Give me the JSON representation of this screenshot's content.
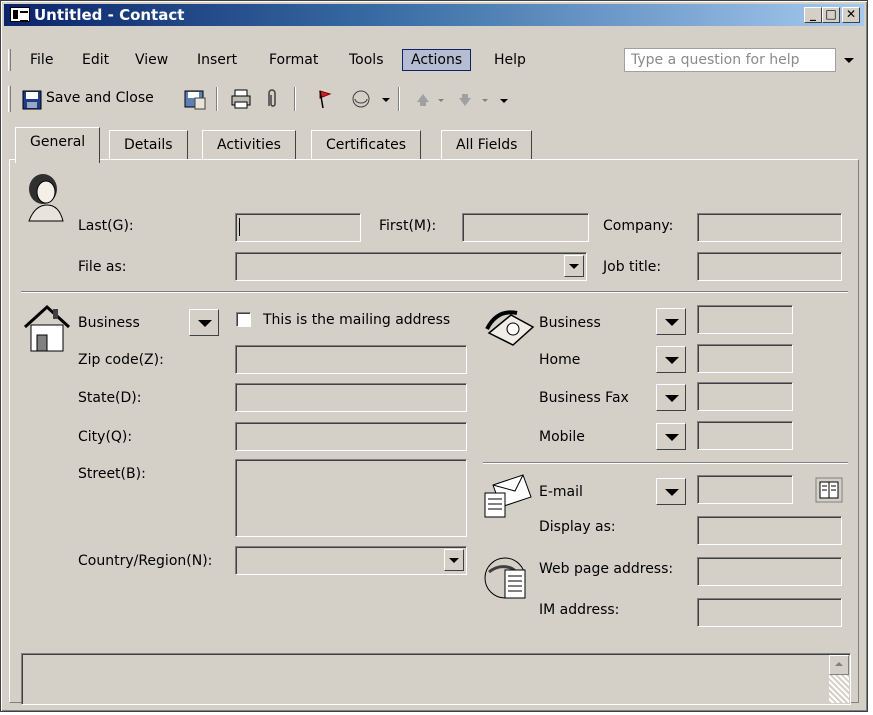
{
  "window": {
    "title": "Untitled - Contact"
  },
  "caption_buttons": {
    "minimize": "_",
    "maximize": "□",
    "close": "✕"
  },
  "menu": {
    "items": [
      "File",
      "Edit",
      "View",
      "Insert",
      "Format",
      "Tools",
      "Actions",
      "Help"
    ],
    "help_placeholder": "Type a question for help"
  },
  "toolbar": {
    "save_close": "Save and Close"
  },
  "tabs": [
    "General",
    "Details",
    "Activities",
    "Certificates",
    "All Fields"
  ],
  "name_section": {
    "last_label": "Last(G):",
    "first_label": "First(M):",
    "company_label": "Company:",
    "file_as_label": "File as:",
    "job_title_label": "Job title:"
  },
  "address_section": {
    "type": "Business",
    "mailing_label": "This is the mailing address",
    "zip_label": "Zip code(Z):",
    "state_label": "State(D):",
    "city_label": "City(Q):",
    "street_label": "Street(B):",
    "country_label": "Country/Region(N):"
  },
  "phone_section": {
    "phones": [
      "Business",
      "Home",
      "Business Fax",
      "Mobile"
    ]
  },
  "email_section": {
    "email_label": "E-mail",
    "display_as_label": "Display as:",
    "web_label": "Web page address:",
    "im_label": "IM address:"
  },
  "colors": {
    "face": "#d4d0c8",
    "title_start": "#0a246a",
    "title_end": "#a6caf0",
    "menu_highlight": "#b6bdd2"
  }
}
